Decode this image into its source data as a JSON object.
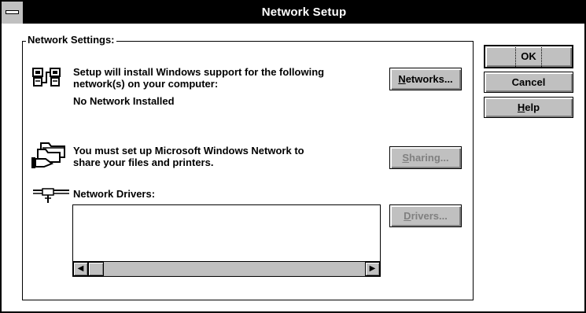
{
  "window": {
    "title": "Network Setup"
  },
  "group": {
    "label": "Network Settings:"
  },
  "networks": {
    "line1": "Setup will install Windows support for the following",
    "line2": "network(s) on your computer:",
    "status": "No Network Installed",
    "button_mnemonic": "N",
    "button_rest": "etworks..."
  },
  "sharing": {
    "line1": "You must set up Microsoft Windows Network to",
    "line2": "share your files and printers.",
    "button_mnemonic": "S",
    "button_rest": "haring..."
  },
  "drivers": {
    "label": "Network Drivers:",
    "button_mnemonic": "D",
    "button_rest": "rivers..."
  },
  "buttons": {
    "ok": "OK",
    "cancel": "Cancel",
    "help_mnemonic": "H",
    "help_rest": "elp"
  },
  "icons": {
    "network": "network-computers-icon",
    "sharing": "shared-folder-hand-icon",
    "drivers": "network-cable-icon",
    "scroll_left": "left-arrow-icon",
    "scroll_right": "right-arrow-icon"
  }
}
